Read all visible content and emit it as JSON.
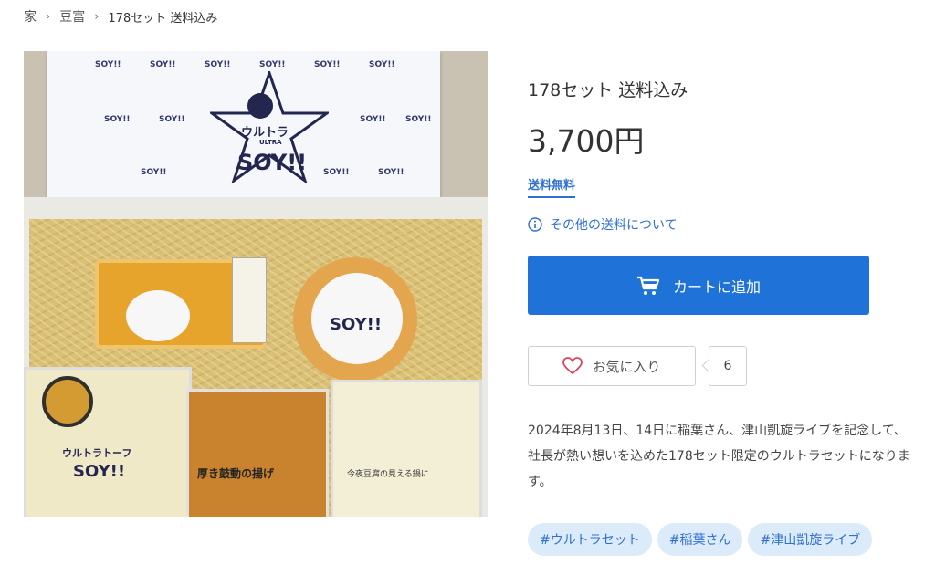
{
  "breadcrumb": {
    "items": [
      "家",
      "豆富"
    ],
    "current": "178セット 送料込み",
    "separator": "›"
  },
  "product": {
    "title": "178セット 送料込み",
    "price": "3,700円",
    "shipping_free_label": "送料無料",
    "other_shipping_label": "その他の送料について",
    "add_to_cart_label": "カートに追加",
    "favorite_label": "お気に入り",
    "favorite_count": "6",
    "description": "2024年8月13日、14日に稲葉さん、津山凱旋ライブを記念して、社長が熱い想いを込めた178セット限定のウルトラセットになります。",
    "tags": [
      "#ウルトラセット",
      "#稲葉さん",
      "#津山凱旋ライブ"
    ]
  },
  "image": {
    "lid_brand": "ウルトラ",
    "lid_brand_sub": "ULTRA",
    "lid_logo": "SOY!!",
    "fried_tofu_label": "厚き鼓動の揚げ",
    "tofu_label": "今夜豆腐の見える鍋に",
    "tofu_brand": "ウルトラトーフ"
  },
  "colors": {
    "accent": "#1e72d8",
    "link": "#2f6fd3",
    "tag_bg": "#dcebf9"
  },
  "icons": {
    "info": "info-circle-icon",
    "cart": "cart-icon",
    "heart": "heart-icon"
  }
}
